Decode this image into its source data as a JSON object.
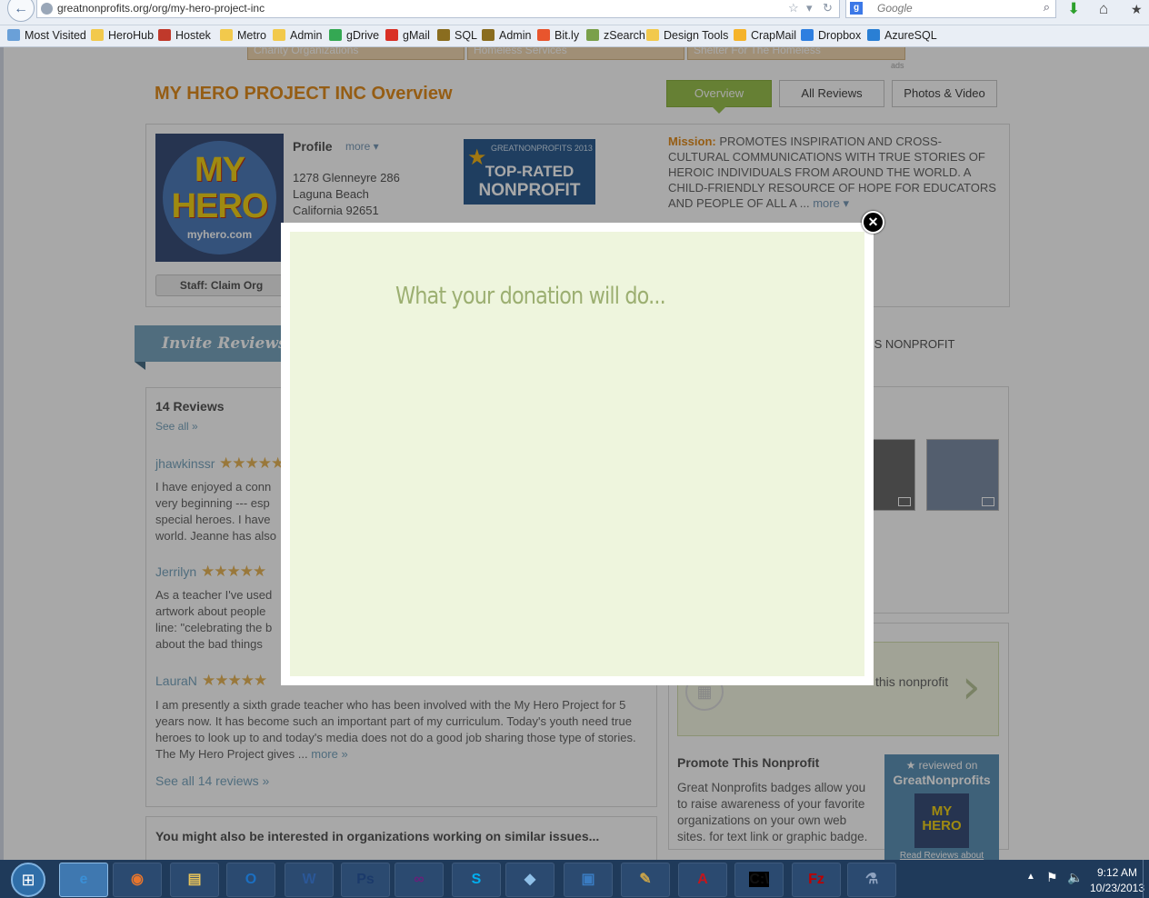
{
  "browser": {
    "back_glyph": "←",
    "url": "greatnonprofits.org/org/my-hero-project-inc",
    "url_tools": [
      "☆",
      "▾",
      "↻"
    ],
    "search_engine_letter": "g",
    "search_placeholder": "Google",
    "search_icon": "⌕",
    "download_glyph": "⬇",
    "home_glyph": "⌂",
    "ext_glyph": "★"
  },
  "bookmarks": [
    {
      "label": "Most Visited",
      "icon": "#6aa0d8"
    },
    {
      "label": "HeroHub",
      "icon": "#f2c94c"
    },
    {
      "label": "Hostek",
      "icon": "#c0392b"
    },
    {
      "label": "Metro",
      "icon": "#f2c94c"
    },
    {
      "label": "Admin",
      "icon": "#f2c94c"
    },
    {
      "label": "gDrive",
      "icon": "#34a853"
    },
    {
      "label": "gMail",
      "icon": "#d93025"
    },
    {
      "label": "SQL",
      "icon": "#8a6d1f"
    },
    {
      "label": "Admin",
      "icon": "#8a6d1f"
    },
    {
      "label": "Bit.ly",
      "icon": "#e8552d"
    },
    {
      "label": "zSearch",
      "icon": "#7aa04a"
    },
    {
      "label": "Design Tools",
      "icon": "#f2c94c"
    },
    {
      "label": "CrapMail",
      "icon": "#f5b32a"
    },
    {
      "label": "Dropbox",
      "icon": "#2f7fe0"
    },
    {
      "label": "AzureSQL",
      "icon": "#2a7fd4"
    }
  ],
  "category_tabs": [
    "Charity Organizations",
    "Homeless Services",
    "Shelter For The Homeless"
  ],
  "ads_label": "ads",
  "org": {
    "title": "MY HERO PROJECT INC Overview",
    "tabs": {
      "overview": "Overview",
      "reviews": "All Reviews",
      "photos": "Photos & Video"
    },
    "profile_label": "Profile",
    "profile_more": "more ▾",
    "address": [
      "1278 Glenneyre 286",
      "Laguna Beach",
      "California 92651"
    ],
    "claim_button": "Staff: Claim Org",
    "logo": {
      "text": "MY HERO",
      "url": "myhero.com"
    },
    "badge": {
      "year": "GREATNONPROFITS 2013",
      "line1": "TOP-RATED",
      "line2": "NONPROFIT",
      "star": "★"
    },
    "mission_label": "Mission:",
    "mission_text": "PROMOTES INSPIRATION AND CROSS-CULTURAL COMMUNICATIONS WITH TRUE STORIES OF HEROIC INDIVIDUALS FROM AROUND THE WORLD. A CHILD-FRIENDLY RESOURCE OF HOPE FOR EDUCATORS AND PEOPLE OF ALL A ...",
    "mission_more": "more ▾"
  },
  "invite": {
    "banner": "Invite Reviews",
    "tail": "IS NONPROFIT"
  },
  "reviews": {
    "title": "14 Reviews",
    "see_all": "See all »",
    "stars": "★★★★★",
    "r1": {
      "name": "jhawkinssr",
      "lines": [
        "I have enjoyed a conn",
        "very beginning --- esp",
        "special heroes. I have",
        "world. Jeanne has also"
      ]
    },
    "r2": {
      "name": "Jerrilyn",
      "lines": [
        "As a teacher I've used",
        "artwork about people",
        "line: \"celebrating the b",
        "about the bad things"
      ]
    },
    "r3": {
      "name": "LauraN",
      "text": "I am presently a sixth grade teacher who has been involved with the My Hero Project for 5 years now. It has become such an important part of my curriculum. Today's youth need true heroes to look up to and today's media does not do a good job sharing those type of stories. The My Hero Project gives ...",
      "more": "more »"
    },
    "see_all_14": "See all 14 reviews »"
  },
  "similar": "You might also be interested in organizations working on similar issues...",
  "donate": {
    "tail": "this nonprofit",
    "chevron": "›",
    "circle": "▦"
  },
  "promote": {
    "title": "Promote This Nonprofit",
    "text": "Great Nonprofits badges allow you to raise awareness of your favorite organizations on your own web sites. for text link or graphic badge.",
    "badge_line1": "★ reviewed on",
    "badge_line2": "GreatNonprofits",
    "badge_logo": "MY HERO",
    "badge_link": "Read Reviews about"
  },
  "modal": {
    "heading": "What your donation will do...",
    "close": "✕"
  },
  "taskbar": {
    "start": "⊞",
    "apps": [
      {
        "name": "ie",
        "glyph": "e",
        "color": "#3a8fd6",
        "active": true
      },
      {
        "name": "firefox",
        "glyph": "◉",
        "color": "#e8762d",
        "active": false
      },
      {
        "name": "explorer",
        "glyph": "▤",
        "color": "#e7c35a",
        "active": false
      },
      {
        "name": "outlook",
        "glyph": "O",
        "color": "#1b6fc1",
        "active": false
      },
      {
        "name": "word",
        "glyph": "W",
        "color": "#2b5797",
        "active": false
      },
      {
        "name": "photoshop",
        "glyph": "Ps",
        "color": "#1b3a6b",
        "active": false
      },
      {
        "name": "visual-studio",
        "glyph": "∞",
        "color": "#68217a",
        "active": false
      },
      {
        "name": "skype",
        "glyph": "S",
        "color": "#00aff0",
        "active": false
      },
      {
        "name": "sketch",
        "glyph": "◆",
        "color": "#8fc0e8",
        "active": false
      },
      {
        "name": "remote-desktop",
        "glyph": "▣",
        "color": "#3a7cc2",
        "active": false
      },
      {
        "name": "tools",
        "glyph": "✎",
        "color": "#c7a24a",
        "active": false
      },
      {
        "name": "acrobat",
        "glyph": "A",
        "color": "#c4161c",
        "active": false
      },
      {
        "name": "cmd",
        "glyph": "C:\\",
        "color": "#111111",
        "active": false
      },
      {
        "name": "filezilla",
        "glyph": "Fz",
        "color": "#bf0000",
        "active": false
      },
      {
        "name": "network",
        "glyph": "⚗",
        "color": "#8fa3c0",
        "active": false
      }
    ],
    "tray_up": "▲",
    "tray_flag": "⚑",
    "tray_vol": "🔈",
    "time": "9:12 AM",
    "date": "10/23/2013"
  }
}
